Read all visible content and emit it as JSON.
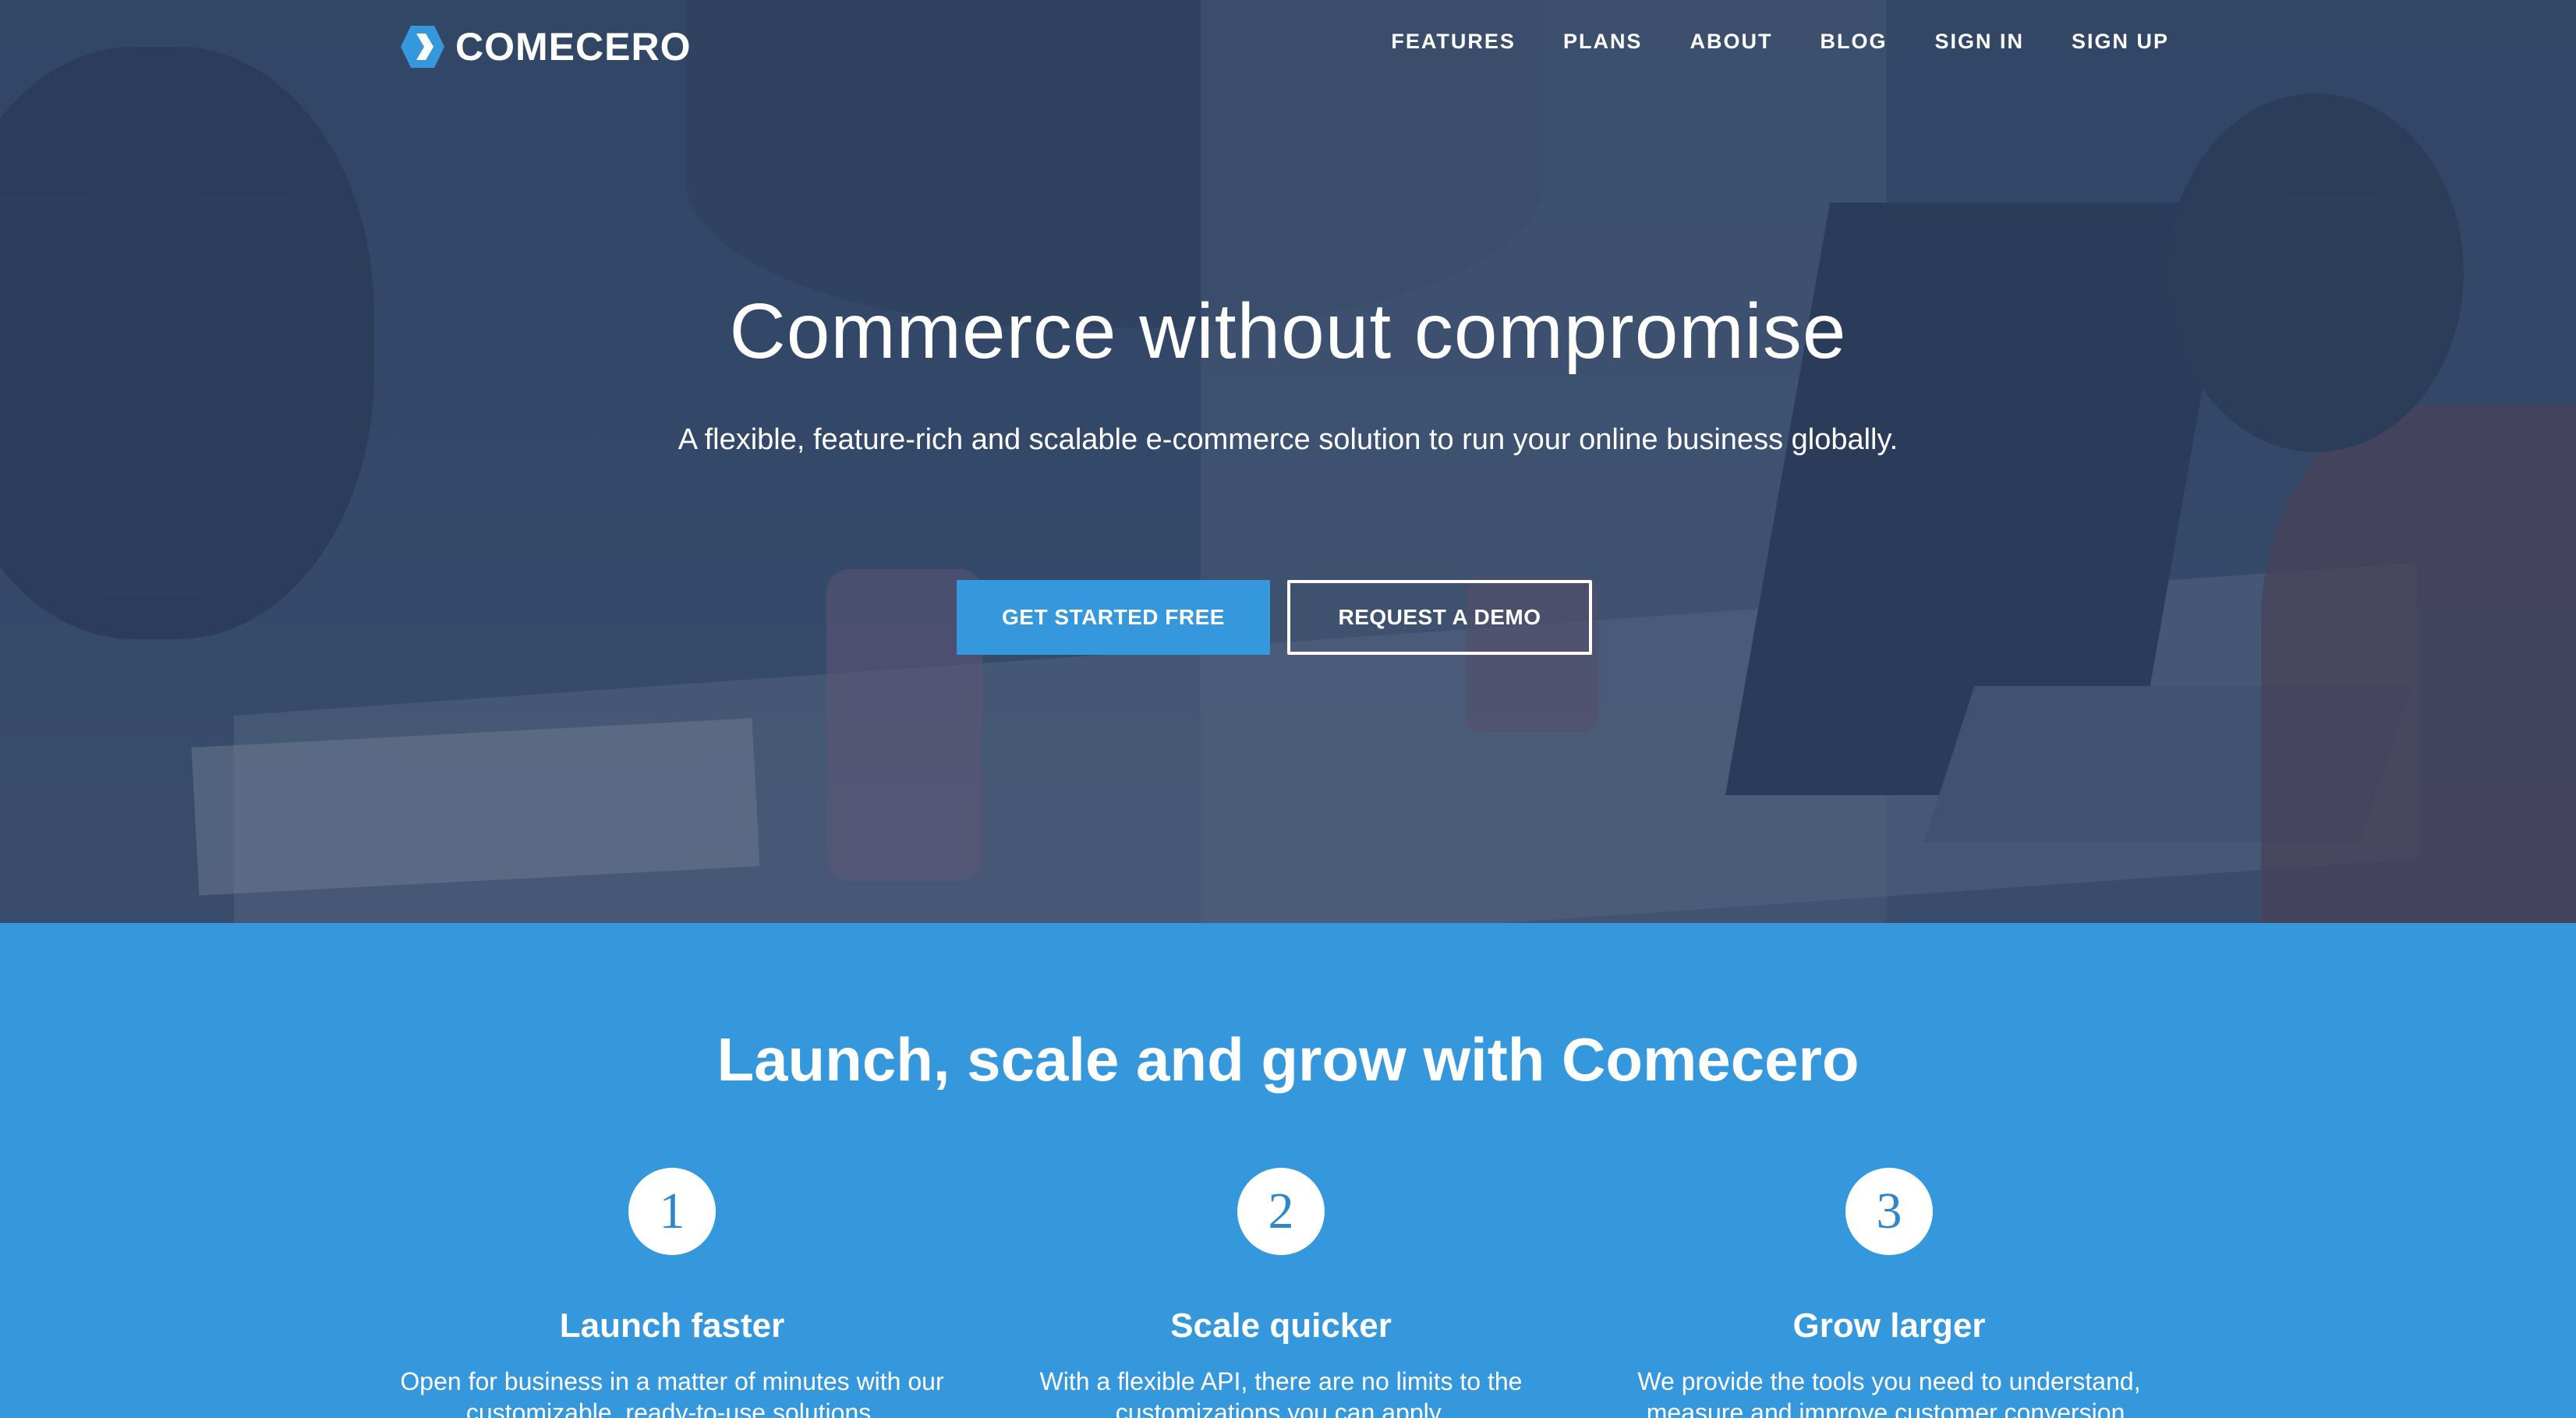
{
  "brand": {
    "name": "COMECERO",
    "logo_icon": "hexagon-chevron-icon",
    "accent": "#3597dc"
  },
  "nav": {
    "items": [
      {
        "label": "FEATURES"
      },
      {
        "label": "PLANS"
      },
      {
        "label": "ABOUT"
      },
      {
        "label": "BLOG"
      },
      {
        "label": "SIGN IN"
      },
      {
        "label": "SIGN UP"
      }
    ]
  },
  "hero": {
    "title": "Commerce without compromise",
    "subtitle": "A flexible, feature-rich and scalable e-commerce solution to run your online business globally.",
    "primary_cta": "GET STARTED FREE",
    "secondary_cta": "REQUEST A DEMO"
  },
  "features": {
    "title": "Launch, scale and grow with Comecero",
    "columns": [
      {
        "number": "1",
        "title": "Launch faster",
        "text": "Open for business in a matter of minutes with our customizable, ready-to-use solutions."
      },
      {
        "number": "2",
        "title": "Scale quicker",
        "text": "With a flexible API, there are no limits to the customizations you can apply."
      },
      {
        "number": "3",
        "title": "Grow larger",
        "text": "We provide the tools you need to understand, measure and improve customer conversion."
      }
    ]
  }
}
